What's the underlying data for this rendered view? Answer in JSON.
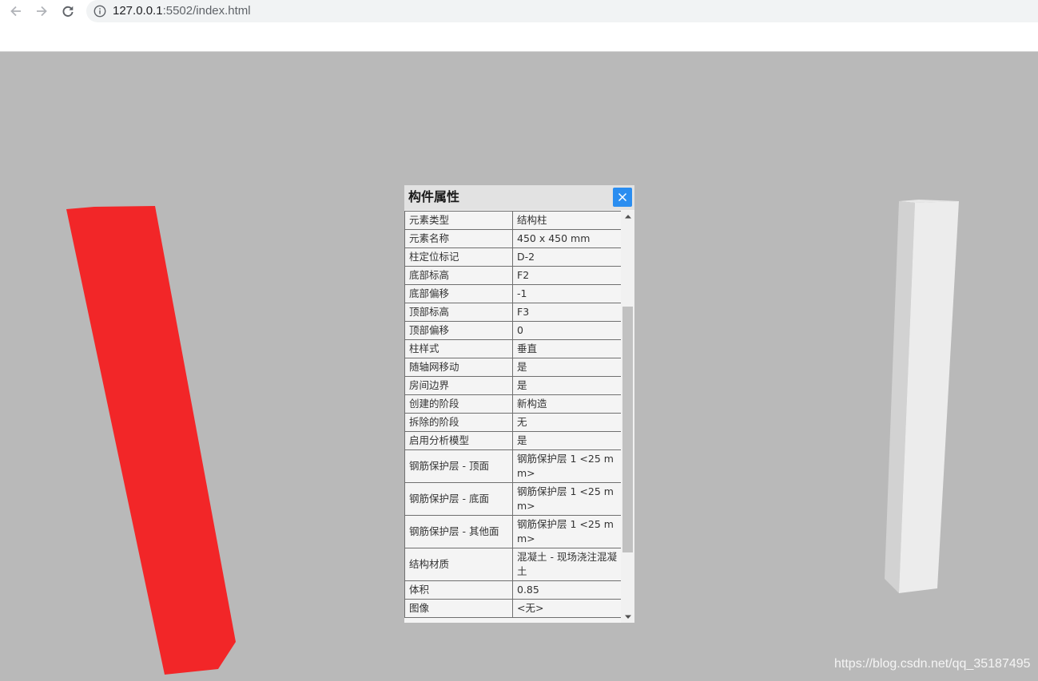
{
  "browser": {
    "url_host": "127.0.0.1",
    "url_rest": ":5502/index.html"
  },
  "panel": {
    "title": "构件属性",
    "rows": [
      {
        "key": "元素类型",
        "value": "结构柱"
      },
      {
        "key": "元素名称",
        "value": "450 x 450 mm"
      },
      {
        "key": "柱定位标记",
        "value": "D-2"
      },
      {
        "key": "底部标高",
        "value": "F2"
      },
      {
        "key": "底部偏移",
        "value": "-1"
      },
      {
        "key": "顶部标高",
        "value": "F3"
      },
      {
        "key": "顶部偏移",
        "value": "0"
      },
      {
        "key": "柱样式",
        "value": "垂直"
      },
      {
        "key": "随轴网移动",
        "value": "是"
      },
      {
        "key": "房间边界",
        "value": "是"
      },
      {
        "key": "创建的阶段",
        "value": "新构造"
      },
      {
        "key": "拆除的阶段",
        "value": "无"
      },
      {
        "key": "启用分析模型",
        "value": "是"
      },
      {
        "key": "钢筋保护层 - 顶面",
        "value": "钢筋保护层 1 <25 mm>"
      },
      {
        "key": "钢筋保护层 - 底面",
        "value": "钢筋保护层 1 <25 mm>"
      },
      {
        "key": "钢筋保护层 - 其他面",
        "value": "钢筋保护层 1 <25 mm>"
      },
      {
        "key": "结构材质",
        "value": "混凝土 - 现场浇注混凝土"
      },
      {
        "key": "体积",
        "value": "0.85"
      },
      {
        "key": "图像",
        "value": "<无>"
      }
    ]
  },
  "colors": {
    "viewport_bg": "#b9b9b9",
    "selected_column": "#f22628",
    "column_front": "#ececec",
    "column_side": "#d2d2d2",
    "close_button": "#2a8df0"
  },
  "watermark": "https://blog.csdn.net/qq_35187495"
}
